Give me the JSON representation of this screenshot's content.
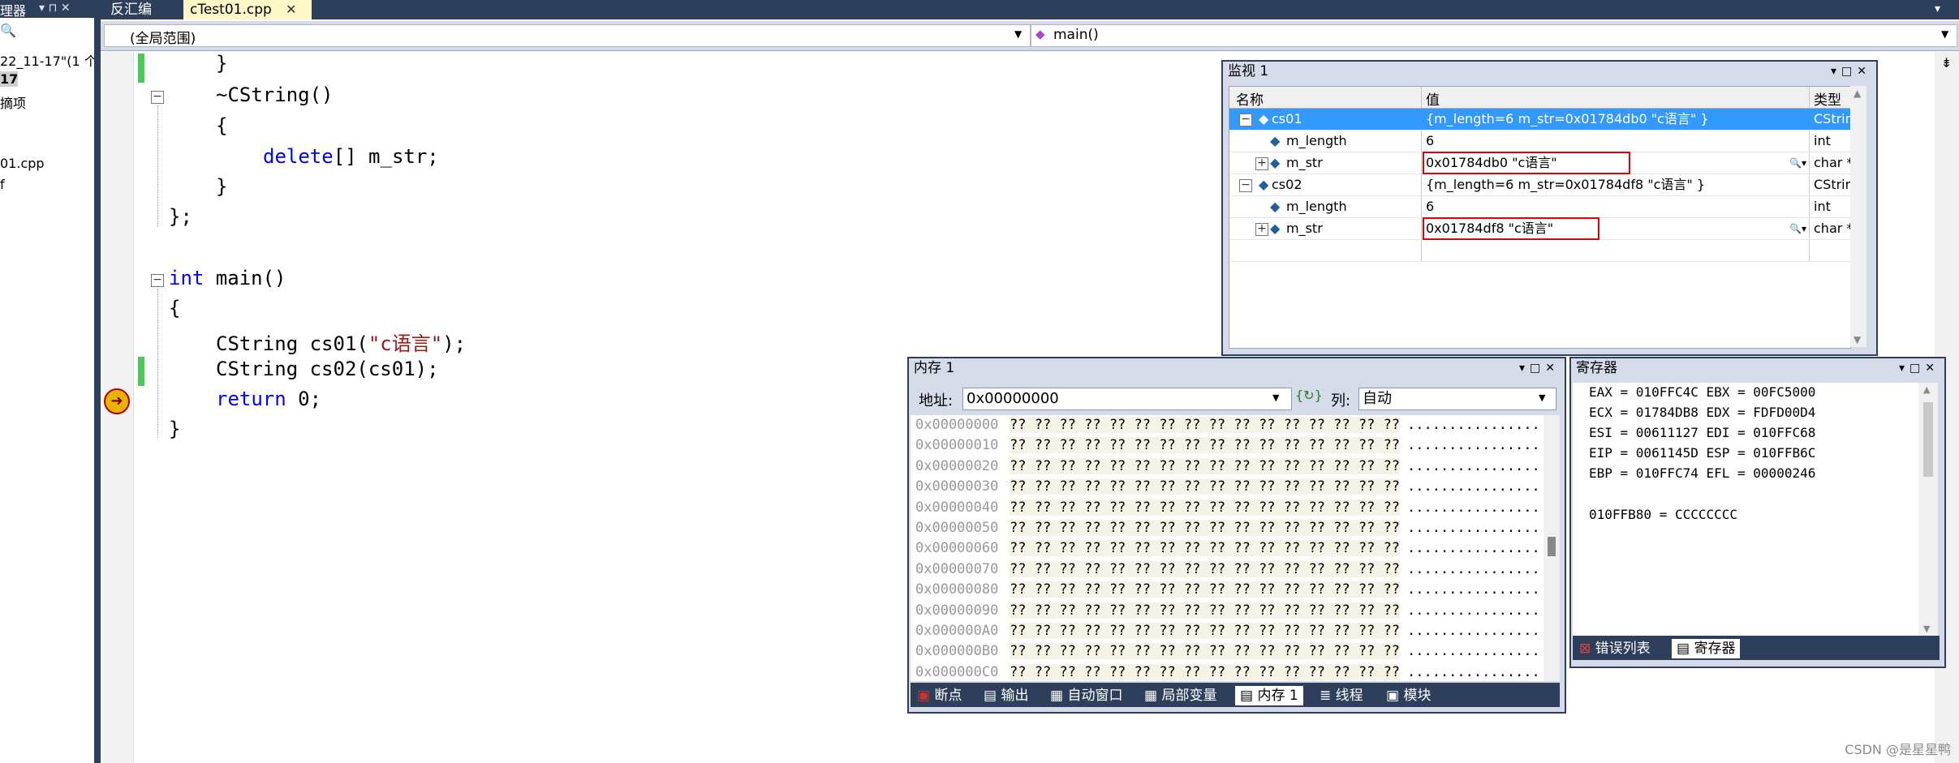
{
  "solution_explorer": {
    "header": "理器",
    "pin": "▾ ⊓ ✕",
    "lines": [
      "22_11-17\"(1 个",
      "17",
      "摘项",
      "01.cpp",
      "f"
    ]
  },
  "tabs": {
    "disasm": "反汇编",
    "file": "cTest01.cpp",
    "close": "✕",
    "overflow": "▾"
  },
  "nav": {
    "scope": "(全局范围)",
    "function": "main()"
  },
  "code": {
    "l1": "}",
    "l2": "~CString()",
    "l3": "{",
    "l4_kw": "delete",
    "l4_rest": "[] m_str;",
    "l5": "}",
    "l6": "};",
    "l7_kw": "int",
    "l7_rest": " main()",
    "l8": "{",
    "l9_a": "CString cs01(",
    "l9_str": "\"c语言\"",
    "l9_b": ");",
    "l10": "CString cs02(cs01);",
    "l11_kw": "return",
    "l11_rest": " 0;",
    "l12": "}"
  },
  "watch": {
    "title": "监视 1",
    "col_name": "名称",
    "col_value": "值",
    "col_type": "类型",
    "rows": [
      {
        "name": "cs01",
        "value": "{m_length=6 m_str=0x01784db0 \"c语言\" }",
        "type": "CStrin"
      },
      {
        "name": "m_length",
        "value": "6",
        "type": "int"
      },
      {
        "name": "m_str",
        "value": "0x01784db0 \"c语言\"",
        "type": "char *"
      },
      {
        "name": "cs02",
        "value": "{m_length=6 m_str=0x01784df8 \"c语言\" }",
        "type": "CStrin"
      },
      {
        "name": "m_length",
        "value": "6",
        "type": "int"
      },
      {
        "name": "m_str",
        "value": "0x01784df8 \"c语言\"",
        "type": "char *"
      }
    ]
  },
  "memory": {
    "title": "内存 1",
    "address_label": "地址:",
    "address_value": "0x00000000",
    "columns_label": "列:",
    "columns_value": "自动",
    "bytes": "?? ?? ?? ?? ?? ?? ?? ?? ?? ?? ?? ?? ?? ?? ?? ??",
    "ascii": "................",
    "addresses": [
      "0x00000000",
      "0x00000010",
      "0x00000020",
      "0x00000030",
      "0x00000040",
      "0x00000050",
      "0x00000060",
      "0x00000070",
      "0x00000080",
      "0x00000090",
      "0x000000A0",
      "0x000000B0",
      "0x000000C0"
    ],
    "tabs": [
      "断点",
      "输出",
      "自动窗口",
      "局部变量",
      "内存 1",
      "线程",
      "模块"
    ]
  },
  "registers": {
    "title": "寄存器",
    "lines": [
      "EAX = 010FFC4C EBX = 00FC5000",
      "ECX = 01784DB8 EDX = FDFD00D4",
      "ESI = 00611127 EDI = 010FFC68",
      "EIP = 0061145D ESP = 010FFB6C",
      "EBP = 010FFC74 EFL = 00000246",
      "",
      "010FFB80 = CCCCCCCC"
    ],
    "tabs": [
      "错误列表",
      "寄存器"
    ]
  },
  "watermark": "CSDN @是星星鸭"
}
